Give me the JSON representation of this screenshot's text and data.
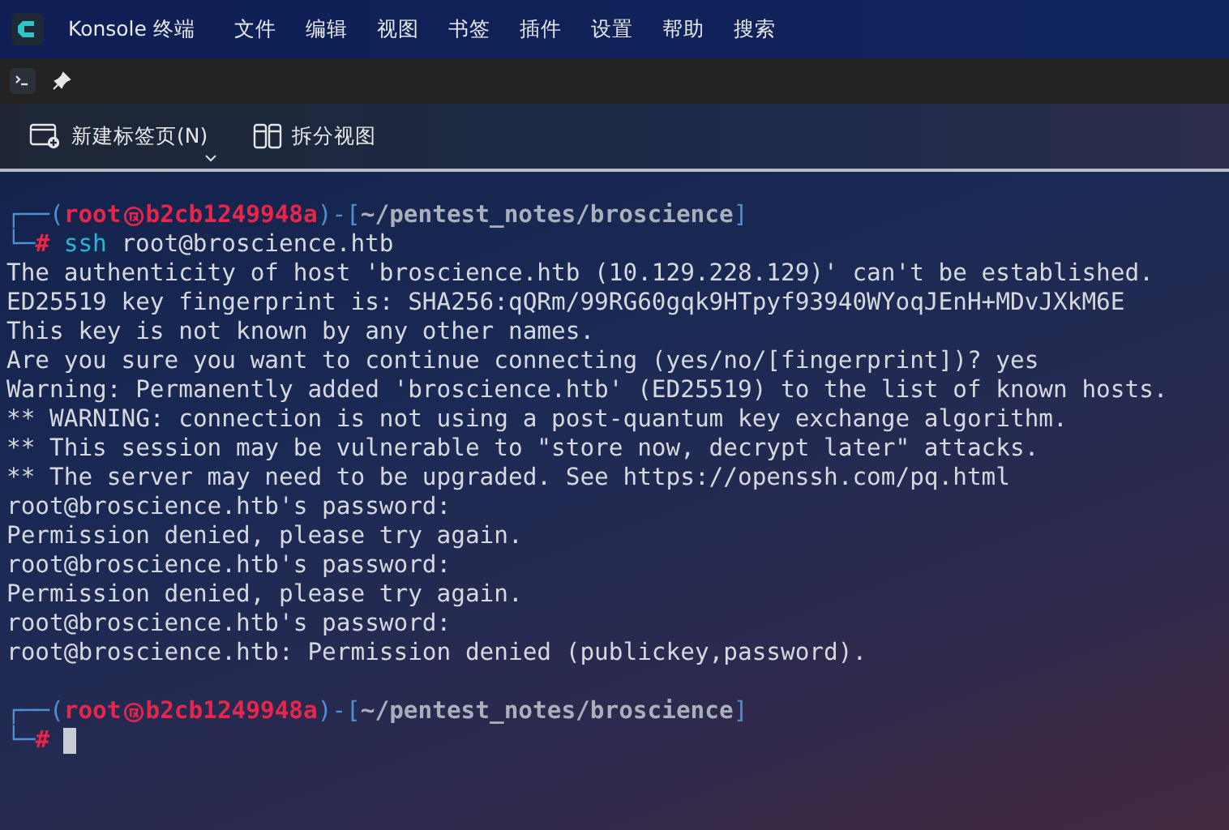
{
  "window": {
    "title": "Konsole 终端"
  },
  "menu": [
    "文件",
    "编辑",
    "视图",
    "书签",
    "插件",
    "设置",
    "帮助",
    "搜索"
  ],
  "toolbar": [
    {
      "kind": "new-tab",
      "label": "新建标签页(N)"
    },
    {
      "kind": "split",
      "label": "拆分视图"
    }
  ],
  "terminal": {
    "lines": [
      {
        "kind": "prompt",
        "frame_top": "┌──(",
        "user": "root",
        "host": "b2cb1249948a",
        "mid": ")-[",
        "path": "~/pentest_notes/broscience",
        "close": "]",
        "frame_bottom": "└─",
        "symbol": "#",
        "command": "ssh",
        "args": "root@broscience.htb"
      },
      {
        "kind": "output",
        "text": "The authenticity of host 'broscience.htb (10.129.228.129)' can't be established."
      },
      {
        "kind": "output",
        "text": "ED25519 key fingerprint is: SHA256:qQRm/99RG60gqk9HTpyf93940WYoqJEnH+MDvJXkM6E"
      },
      {
        "kind": "output",
        "text": "This key is not known by any other names."
      },
      {
        "kind": "output",
        "text": "Are you sure you want to continue connecting (yes/no/[fingerprint])? yes"
      },
      {
        "kind": "output",
        "text": "Warning: Permanently added 'broscience.htb' (ED25519) to the list of known hosts."
      },
      {
        "kind": "output",
        "text": "** WARNING: connection is not using a post-quantum key exchange algorithm."
      },
      {
        "kind": "output",
        "text": "** This session may be vulnerable to \"store now, decrypt later\" attacks."
      },
      {
        "kind": "output",
        "text": "** The server may need to be upgraded. See https://openssh.com/pq.html"
      },
      {
        "kind": "output",
        "text": "root@broscience.htb's password:"
      },
      {
        "kind": "output",
        "text": "Permission denied, please try again."
      },
      {
        "kind": "output",
        "text": "root@broscience.htb's password:"
      },
      {
        "kind": "output",
        "text": "Permission denied, please try again."
      },
      {
        "kind": "output",
        "text": "root@broscience.htb's password:"
      },
      {
        "kind": "output",
        "text": "root@broscience.htb: Permission denied (publickey,password)."
      },
      {
        "kind": "blank"
      },
      {
        "kind": "prompt",
        "frame_top": "┌──(",
        "user": "root",
        "host": "b2cb1249948a",
        "mid": ")-[",
        "path": "~/pentest_notes/broscience",
        "close": "]",
        "frame_bottom": "└─",
        "symbol": "#",
        "cursor": true
      }
    ]
  }
}
